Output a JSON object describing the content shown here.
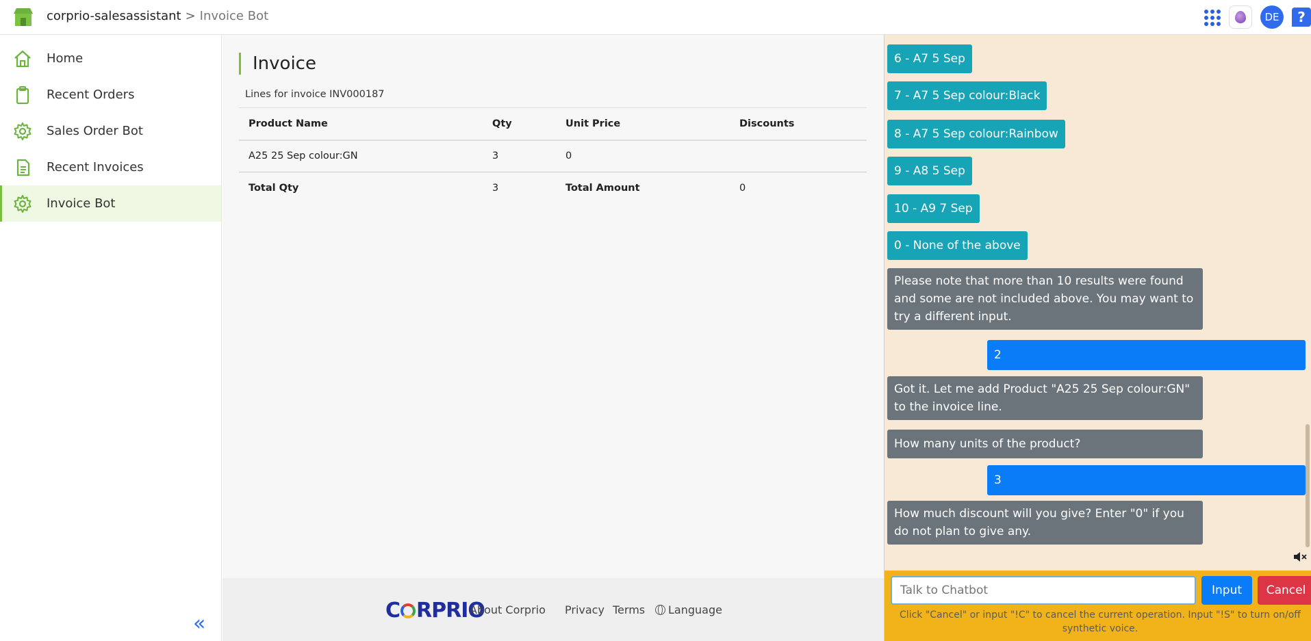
{
  "header": {
    "app_name": "corprio-salesassistant",
    "separator": ">",
    "current_page": "Invoice Bot",
    "avatar_initials": "DE",
    "help_label": "?"
  },
  "sidebar": {
    "items": [
      {
        "label": "Home",
        "icon": "home-icon"
      },
      {
        "label": "Recent Orders",
        "icon": "clipboard-icon"
      },
      {
        "label": "Sales Order Bot",
        "icon": "gear-icon"
      },
      {
        "label": "Recent Invoices",
        "icon": "document-icon"
      },
      {
        "label": "Invoice Bot",
        "icon": "gear-icon",
        "active": true
      }
    ],
    "collapse_label": "«"
  },
  "main": {
    "title": "Invoice",
    "subtitle": "Lines for invoice INV000187",
    "columns": [
      "Product Name",
      "Qty",
      "Unit Price",
      "Discounts"
    ],
    "rows": [
      [
        "A25 25 Sep colour:GN",
        "3",
        "0",
        ""
      ]
    ],
    "total": {
      "qty_label": "Total Qty",
      "qty_value": "3",
      "amount_label": "Total Amount",
      "amount_value": "0"
    }
  },
  "footer": {
    "logo_text_1": "C",
    "logo_text_2": "RPRIO",
    "about": "About Corprio",
    "privacy": "Privacy",
    "terms": "Terms",
    "language": "Language"
  },
  "chat": {
    "options": [
      "6 - A7 5 Sep",
      "7 - A7 5 Sep colour:Black",
      "8 - A7 5 Sep colour:Rainbow",
      "9 - A8 5 Sep",
      "10 - A9 7 Sep",
      "0 - None of the above"
    ],
    "bot_note": "Please note that more than 10 results were found and some are not included above. You may want to try a different input.",
    "user_reply_1": "2",
    "bot_confirm": "Got it. Let me add Product \"A25 25 Sep colour:GN\" to the invoice line.",
    "bot_units": "How many units of the product?",
    "user_reply_2": "3",
    "bot_discount": "How much discount will you give? Enter \"0\" if you do not plan to give any.",
    "input_placeholder": "Talk to Chatbot",
    "input_button": "Input",
    "cancel_button": "Cancel",
    "hint": "Click \"Cancel\" or input \"!C\" to cancel the current operation. Input \"!S\" to turn on/off synthetic voice.",
    "colors": {
      "background": "#f8e9d6",
      "option": "#16a4b6",
      "bot": "#6b737b",
      "user": "#0a7cf7",
      "input_bar": "#f2b31a"
    }
  }
}
